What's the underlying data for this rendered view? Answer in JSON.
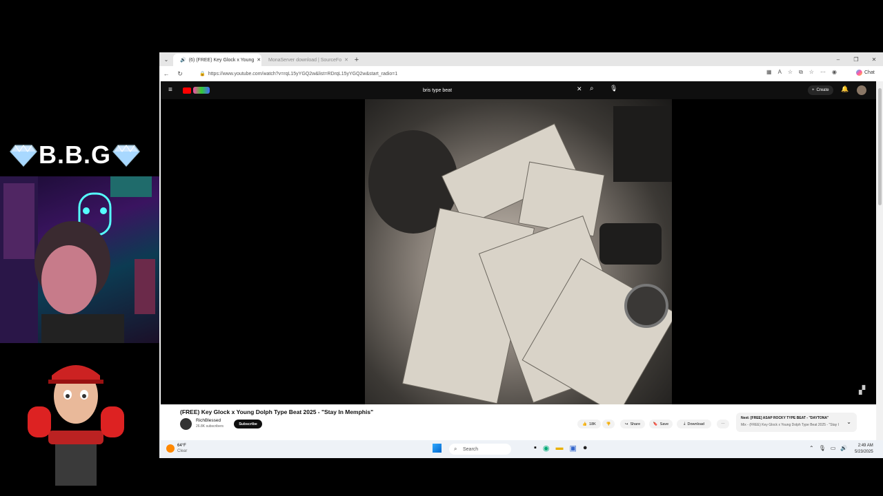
{
  "overlay": {
    "title": "B.B.G"
  },
  "browser": {
    "tabs": [
      {
        "label": "(6) (FREE) Key Glock x Young",
        "active": true
      },
      {
        "label": "MonaServer download | SourceFo",
        "active": false
      }
    ],
    "url": "https://www.youtube.com/watch?v=rqL15yYGQ2w&list=RDrqL15yYGQ2w&start_radio=1",
    "copilot_label": "Chat"
  },
  "youtube": {
    "search_value": "bris type beat",
    "create_label": "Create",
    "video_title": "(FREE) Key Glock x Young Dolph Type Beat 2025 - \"Stay In Memphis\"",
    "channel_name": "RichBlessed",
    "channel_subs": "26.8K subscribers",
    "subscribe_label": "Subscribe",
    "like_count": "18K",
    "share_label": "Share",
    "save_label": "Save",
    "download_label": "Download",
    "next_title": "Next: [FREE] ASAP ROCKY TYPE BEAT - \"DAYTONA\"",
    "next_sub": "Mix - (FREE) Key Glock x Young Dolph Type Beat 2025 - \"Stay I"
  },
  "taskbar": {
    "weather_temp": "64°F",
    "weather_cond": "Clear",
    "search_placeholder": "Search",
    "time": "2:49 AM",
    "date": "5/23/2025"
  },
  "colors": {
    "yt_red": "#ff0000",
    "yt_bg": "#0f0f0f",
    "taskbar_bg": "#eef2f7"
  }
}
